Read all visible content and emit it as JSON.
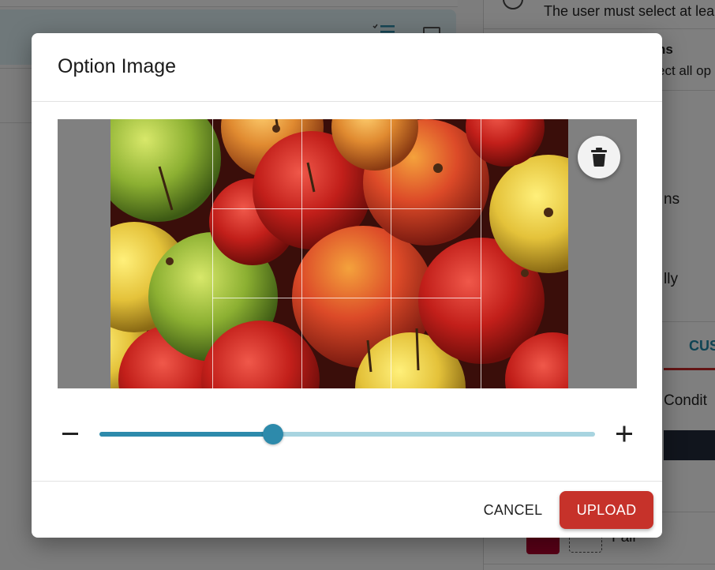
{
  "background": {
    "right_panel": {
      "rule_text": "The user must select at lea",
      "heading_fragment": "ns",
      "subtext_fragment": "ect all op",
      "option_fragment_1": "ns",
      "option_fragment_2": "lly",
      "tab_fragment": "CUS",
      "condition_fragment": "Condit",
      "item_fragment": "Fall"
    }
  },
  "dialog": {
    "title": "Option Image",
    "delete_icon": "trash-icon",
    "zoom": {
      "minus_icon": "minus-icon",
      "plus_icon": "plus-icon",
      "level": 0.35
    },
    "actions": {
      "cancel_label": "CANCEL",
      "upload_label": "UPLOAD"
    }
  },
  "colors": {
    "accent": "#2d8aab",
    "track": "#a8d4e0",
    "primary_button": "#c6322a",
    "overlay": "rgba(0,0,0,0.5)"
  }
}
